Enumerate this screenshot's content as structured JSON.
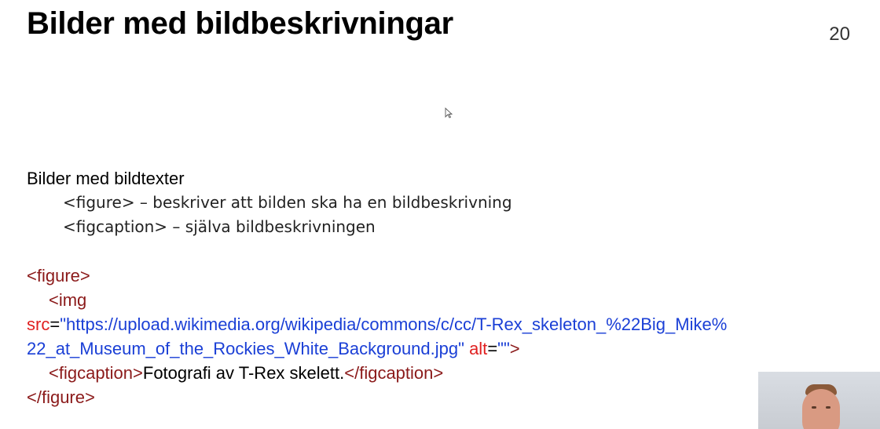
{
  "slide": {
    "title": "Bilder med bildbeskrivningar",
    "number": "20"
  },
  "intro": {
    "heading": "Bilder med bildtexter",
    "items": [
      "<figure> – beskriver att bilden ska ha en bildbeskrivning",
      "<figcaption> – själva bildbeskrivningen"
    ]
  },
  "code": {
    "line1_tag": "<figure>",
    "line2_tag": "<img",
    "line3_attr_src": "src",
    "line3_eq": "=",
    "line3_value": "\"https://upload.wikimedia.org/wikipedia/commons/c/cc/T-Rex_skeleton_%22Big_Mike%",
    "line4_value": "22_at_Museum_of_the_Rockies_White_Background.jpg\"",
    "line4_attr_alt": "alt",
    "line4_eq": "=",
    "line4_alt_value": "\"\"",
    "line4_close": ">",
    "line5_open": "<figcaption>",
    "line5_text": "Fotografi av T-Rex skelett.",
    "line5_close": "</figcaption>",
    "line6_tag": "</figure>"
  },
  "icons": {
    "cursor": "mouse-pointer-icon"
  }
}
